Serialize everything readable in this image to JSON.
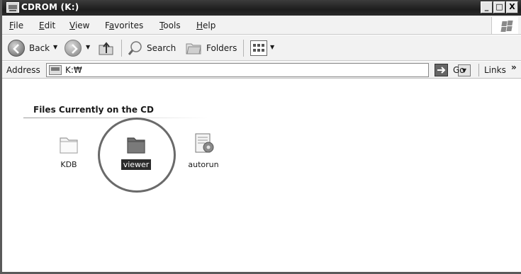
{
  "window": {
    "title": "CDROM (K:)",
    "caption_buttons": {
      "minimize": "_",
      "maximize": "□",
      "close": "X"
    }
  },
  "menu": {
    "items": [
      {
        "label": "File",
        "accel": "F"
      },
      {
        "label": "Edit",
        "accel": "E"
      },
      {
        "label": "View",
        "accel": "V"
      },
      {
        "label": "Favorites",
        "accel": "a"
      },
      {
        "label": "Tools",
        "accel": "T"
      },
      {
        "label": "Help",
        "accel": "H"
      }
    ]
  },
  "toolbar": {
    "back_label": "Back",
    "search_label": "Search",
    "folders_label": "Folders"
  },
  "address": {
    "label": "Address",
    "value": "K:₩",
    "go_label": "Go",
    "links_label": "Links",
    "links_chevron": "»"
  },
  "content": {
    "header": "Files Currently on the CD",
    "files": [
      {
        "name": "KDB",
        "icon": "folder-icon",
        "selected": false
      },
      {
        "name": "viewer",
        "icon": "folder-icon",
        "selected": true
      },
      {
        "name": "autorun",
        "icon": "autorun-file-icon",
        "selected": false
      }
    ]
  }
}
